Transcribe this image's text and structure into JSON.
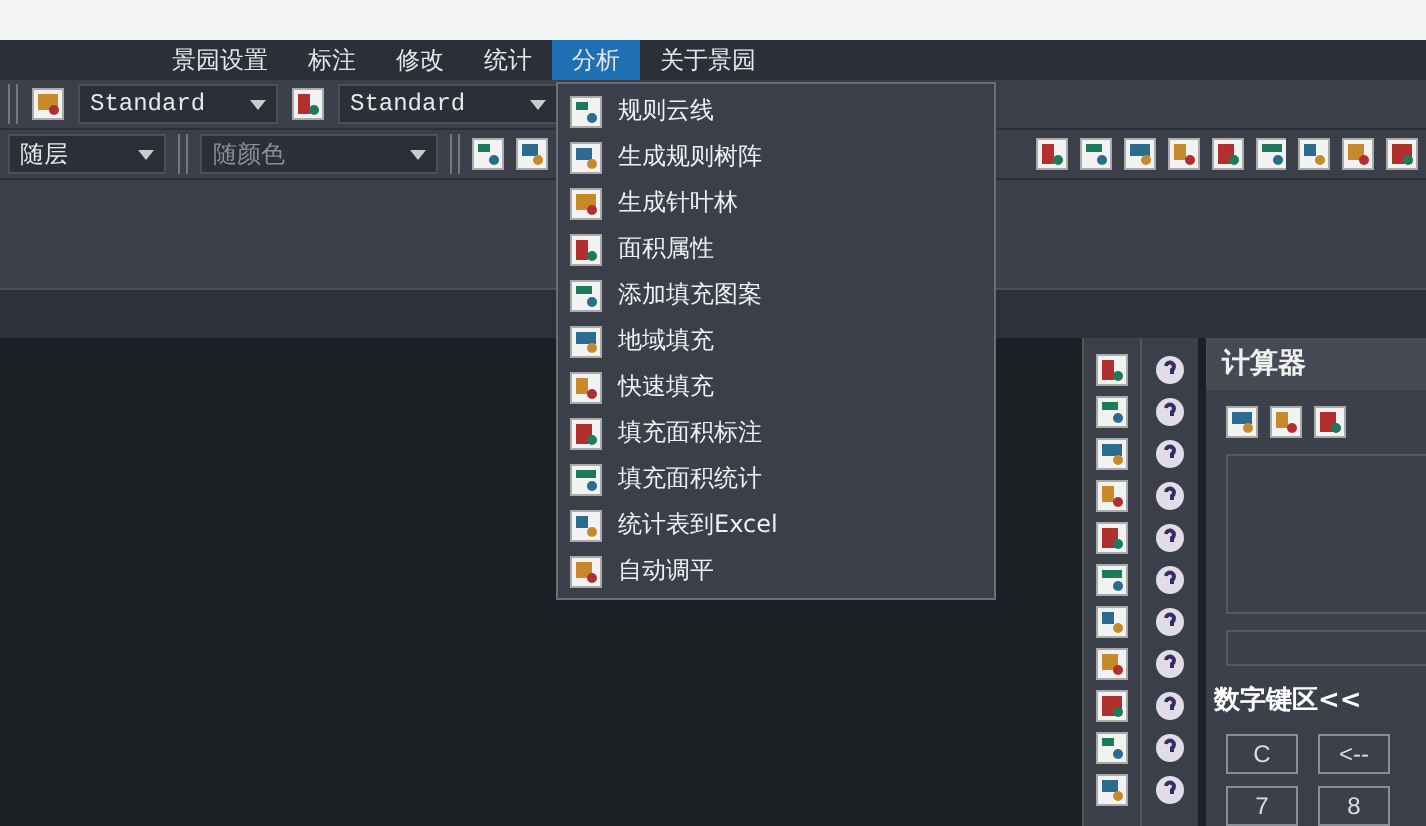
{
  "menu_bar": [
    {
      "label": "景园设置",
      "selected": false
    },
    {
      "label": "标注",
      "selected": false
    },
    {
      "label": "修改",
      "selected": false
    },
    {
      "label": "统计",
      "selected": false
    },
    {
      "label": "分析",
      "selected": true
    },
    {
      "label": "关于景园",
      "selected": false
    }
  ],
  "style_toolbar": {
    "combos": [
      "Standard",
      "Standard"
    ]
  },
  "layer_toolbar": {
    "combos": [
      {
        "value": "随层",
        "disabled": false
      },
      {
        "value": "随颜色",
        "disabled": true
      }
    ]
  },
  "dropdown_menu": {
    "items": [
      "规则云线",
      "生成规则树阵",
      "生成针叶林",
      "面积属性",
      "添加填充图案",
      "地域填充",
      "快速填充",
      "填充面积标注",
      "填充面积统计",
      "统计表到Excel",
      "自动调平"
    ]
  },
  "calculator": {
    "title": "计算器",
    "keypad_label": "数字键区<<",
    "keys": [
      "C",
      "<--",
      "7",
      "8"
    ]
  }
}
